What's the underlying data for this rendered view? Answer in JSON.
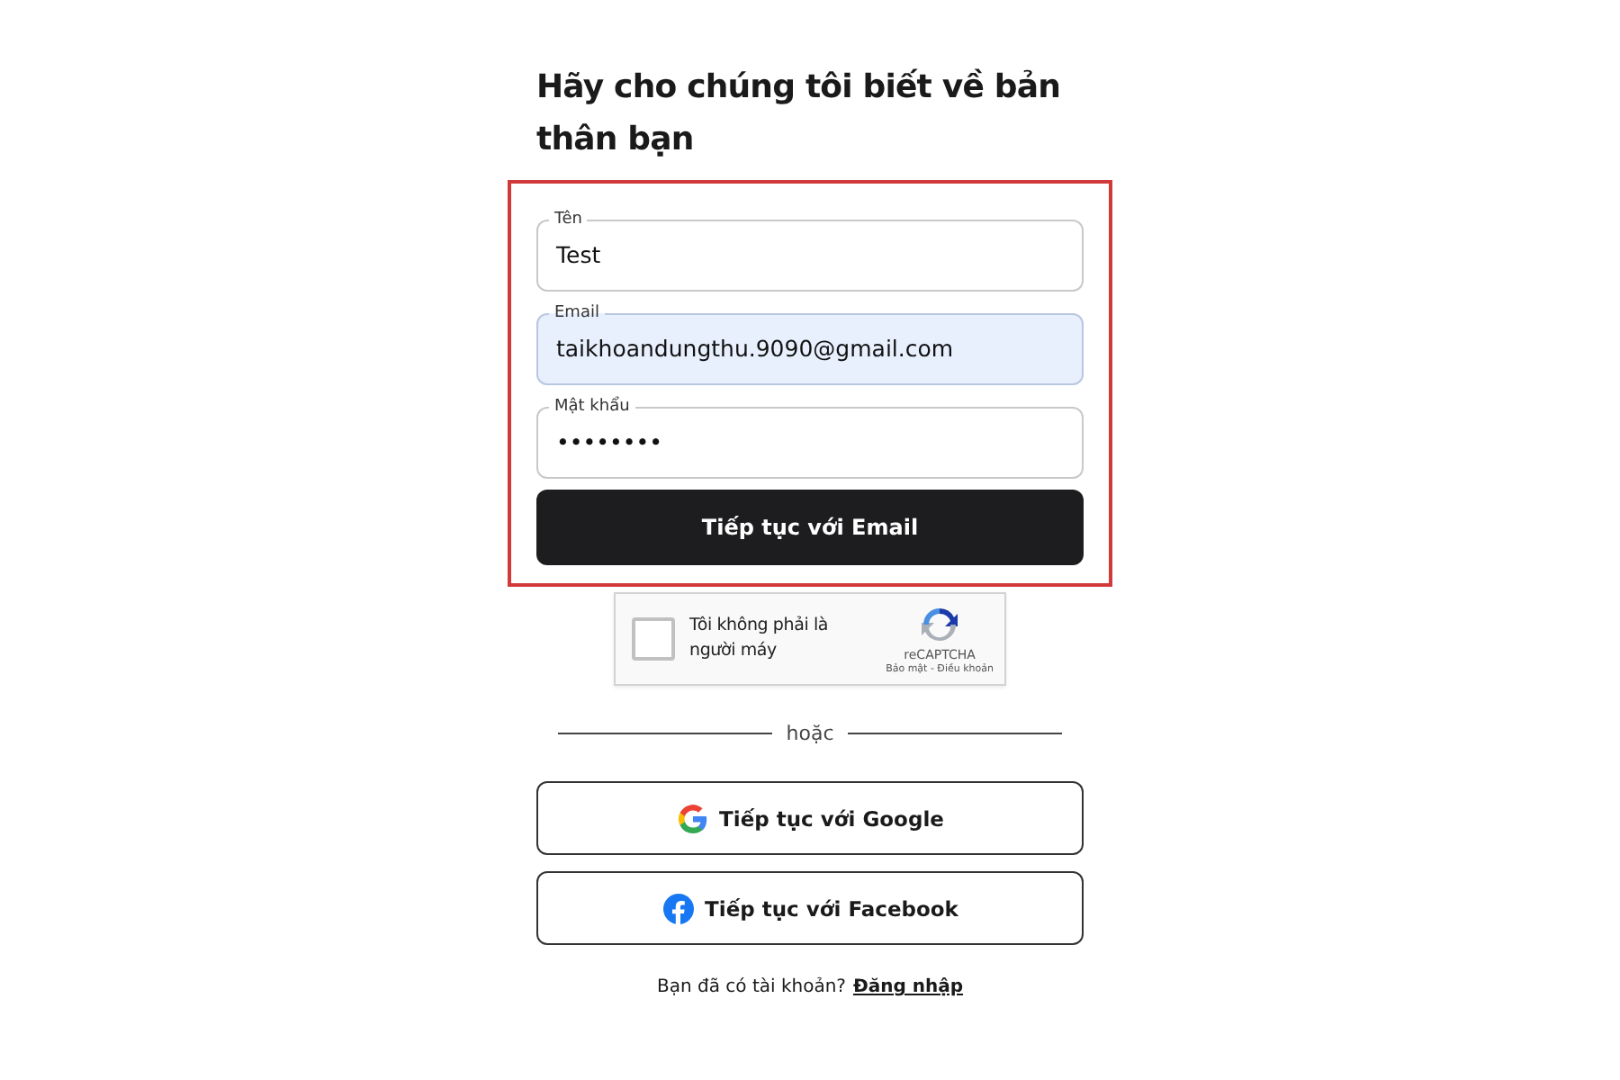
{
  "title": "Hãy cho chúng tôi biết về bản thân bạn",
  "highlight": {
    "shown": true,
    "color": "#d23a3a"
  },
  "fields": [
    {
      "label": "Tên",
      "value": "Test",
      "autofilled": false
    },
    {
      "label": "Email",
      "value": "taikhoandungthu.9090@gmail.com",
      "autofilled": true
    },
    {
      "label": "Mật khẩu",
      "value": "••••••••",
      "autofilled": false
    }
  ],
  "submit_button": "Tiếp tục với Email",
  "captcha": {
    "label": "Tôi không phải là người máy",
    "checked": false,
    "brand": "reCAPTCHA",
    "links": "Bảo mật - Điều khoản"
  },
  "divider_text": "hoặc",
  "social_buttons": [
    {
      "kind": "google",
      "label": "Tiếp tục với Google"
    },
    {
      "kind": "facebook",
      "label": "Tiếp tục với Facebook"
    }
  ],
  "footer": {
    "text": "Bạn đã có tài khoản?",
    "link": "Đăng nhập"
  }
}
